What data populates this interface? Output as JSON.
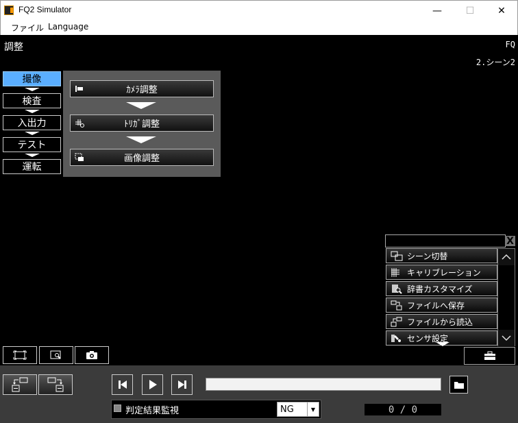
{
  "window": {
    "title": "FQ2 Simulator",
    "minimize_glyph": "—",
    "maximize_glyph": "☐",
    "close_glyph": "✕"
  },
  "menu": {
    "items": [
      "ファイル",
      "Language"
    ]
  },
  "header": {
    "page_title": "調整",
    "device": "FQ",
    "scene": "2.シーン2"
  },
  "nav": {
    "items": [
      {
        "label": "撮像",
        "active": true
      },
      {
        "label": "検査",
        "active": false
      },
      {
        "label": "入出力",
        "active": false
      },
      {
        "label": "テスト",
        "active": false
      },
      {
        "label": "運転",
        "active": false
      }
    ]
  },
  "submenu": {
    "items": [
      {
        "label": "ｶﾒﾗ調整",
        "icon": "camera-adjust-icon"
      },
      {
        "label": "ﾄﾘｶﾞ調整",
        "icon": "trigger-adjust-icon"
      },
      {
        "label": "画像調整",
        "icon": "image-adjust-icon"
      }
    ]
  },
  "tools_panel": {
    "close_glyph": "X",
    "items": [
      {
        "label": "シーン切替",
        "icon": "scene-switch-icon"
      },
      {
        "label": "キャリブレーション",
        "icon": "calibration-icon"
      },
      {
        "label": "辞書カスタマイズ",
        "icon": "dictionary-icon"
      },
      {
        "label": "ファイルへ保存",
        "icon": "save-file-icon"
      },
      {
        "label": "ファイルから読込",
        "icon": "load-file-icon"
      },
      {
        "label": "センサ設定",
        "icon": "sensor-settings-icon"
      }
    ]
  },
  "bottom": {
    "monitor_label": "判定結果監視",
    "monitor_checked": false,
    "judge_select": "NG",
    "counter": "0 / 0",
    "progress": 0
  },
  "colors": {
    "accent": "#5aaeff",
    "background": "#000000",
    "panel": "#5a5a5a",
    "bottom_bar": "#3b3b3b"
  }
}
